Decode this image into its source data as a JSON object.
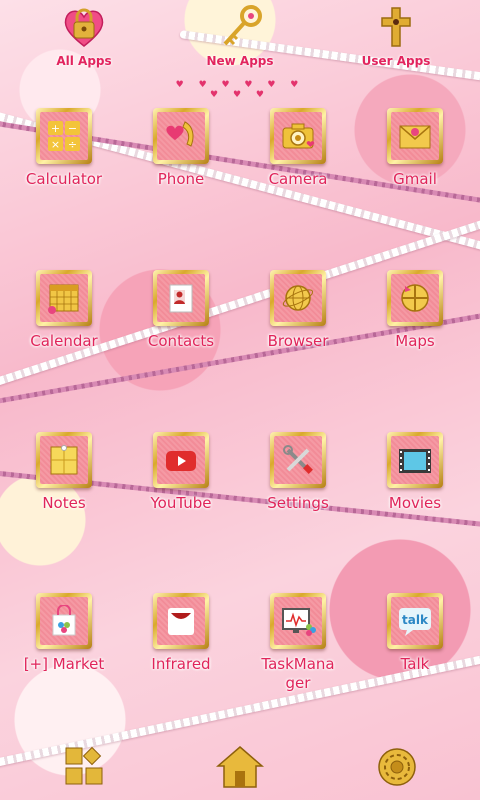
{
  "tabs": [
    {
      "label": "All Apps",
      "icon": "lock-heart-icon"
    },
    {
      "label": "New Apps",
      "icon": "key-icon"
    },
    {
      "label": "User Apps",
      "icon": "cross-icon"
    }
  ],
  "page_indicator": "♥ ♥ ♥ ♥ ♥ ♥ ♥ ♥ ♥",
  "apps": [
    {
      "label": "Calculator",
      "icon": "calculator-icon"
    },
    {
      "label": "Phone",
      "icon": "phone-icon"
    },
    {
      "label": "Camera",
      "icon": "camera-icon"
    },
    {
      "label": "Gmail",
      "icon": "envelope-icon"
    },
    {
      "label": "Calendar",
      "icon": "calendar-icon"
    },
    {
      "label": "Contacts",
      "icon": "contact-card-icon"
    },
    {
      "label": "Browser",
      "icon": "globe-icon"
    },
    {
      "label": "Maps",
      "icon": "map-icon"
    },
    {
      "label": "Notes",
      "icon": "notes-icon"
    },
    {
      "label": "YouTube",
      "icon": "play-icon"
    },
    {
      "label": "Settings",
      "icon": "tools-icon"
    },
    {
      "label": "Movies",
      "icon": "film-icon"
    },
    {
      "label": "[+] Market",
      "icon": "shopping-bag-icon"
    },
    {
      "label": "Infrared",
      "icon": "remote-icon"
    },
    {
      "label": "TaskManager",
      "icon": "monitor-icon"
    },
    {
      "label": "Talk",
      "icon": "talk-bubble-icon"
    }
  ],
  "dock": [
    {
      "icon": "widgets-icon"
    },
    {
      "icon": "home-icon"
    },
    {
      "icon": "settings-gear-icon"
    }
  ],
  "talk_text": "talk"
}
